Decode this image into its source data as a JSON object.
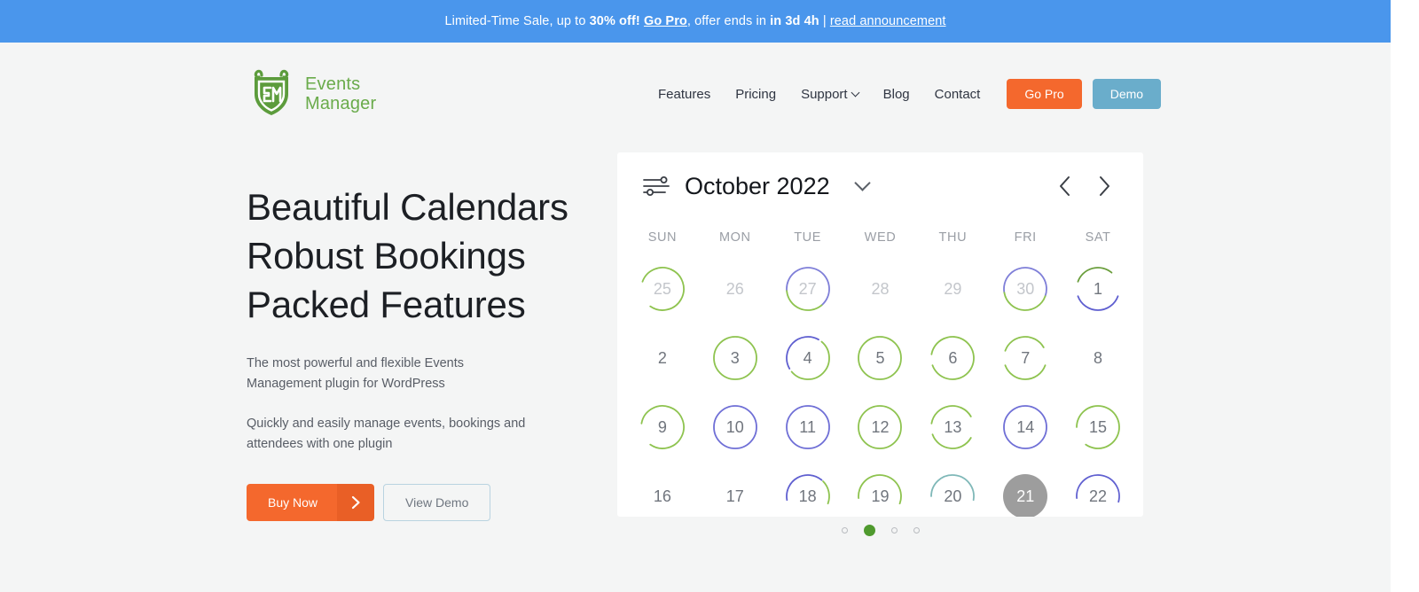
{
  "announcement": {
    "prefix": "Limited-Time Sale, up to ",
    "discount": "30% off!",
    "go_pro_link": "Go Pro",
    "middle": ", offer ends in ",
    "countdown": "in 3d 4h",
    "separator": " | ",
    "read_link": "read announcement",
    "background": "#4a96ec"
  },
  "header": {
    "brand": {
      "line1": "Events",
      "line2": "Manager",
      "logo_icon": "shield-em-logo-icon",
      "color": "#6aab4b"
    },
    "nav": [
      {
        "label": "Features",
        "has_caret": false
      },
      {
        "label": "Pricing",
        "has_caret": false
      },
      {
        "label": "Support",
        "has_caret": true
      },
      {
        "label": "Blog",
        "has_caret": false
      },
      {
        "label": "Contact",
        "has_caret": false
      }
    ],
    "go_pro_button": {
      "label": "Go Pro",
      "color": "#f4682d"
    },
    "demo_button": {
      "label": "Demo",
      "color": "#6aadcb"
    }
  },
  "hero": {
    "heading_lines": [
      "Beautiful Calendars",
      "Robust Bookings",
      "Packed Features"
    ],
    "paragraph_1": "The most powerful and flexible Events Management plugin for WordPress",
    "paragraph_2": "Quickly and easily manage events, bookings and attendees with one plugin",
    "buy_now_button": {
      "label": "Buy Now",
      "arrow_icon": "chevron-right-icon",
      "color": "#f4682d"
    },
    "view_demo_button": {
      "label": "View Demo"
    }
  },
  "calendar": {
    "filter_icon": "sliders-filter-icon",
    "title": "October 2022",
    "dropdown_icon": "chevron-down-icon",
    "prev_icon": "chevron-left-icon",
    "next_icon": "chevron-right-icon",
    "weekdays": [
      "SUN",
      "MON",
      "TUE",
      "WED",
      "THU",
      "FRI",
      "SAT"
    ],
    "colors": {
      "green": "#8ec34f",
      "purple": "#6f6fd6",
      "teal": "#7fb8b8",
      "today_fill": "#9d9d9d"
    },
    "weeks": [
      [
        {
          "day": "25",
          "muted": true,
          "today": false,
          "arcs": [
            {
              "color": "#8ec34f",
              "start": -70,
              "end": 215
            }
          ]
        },
        {
          "day": "26",
          "muted": true,
          "today": false,
          "arcs": []
        },
        {
          "day": "27",
          "muted": true,
          "today": false,
          "arcs": [
            {
              "color": "#7f7fd8",
              "start": -95,
              "end": 140
            },
            {
              "color": "#8ec34f",
              "start": 140,
              "end": 265
            }
          ]
        },
        {
          "day": "28",
          "muted": true,
          "today": false,
          "arcs": []
        },
        {
          "day": "29",
          "muted": true,
          "today": false,
          "arcs": []
        },
        {
          "day": "30",
          "muted": true,
          "today": false,
          "arcs": [
            {
              "color": "#7f7fd8",
              "start": -100,
              "end": 110
            },
            {
              "color": "#8ec34f",
              "start": 110,
              "end": 260
            }
          ]
        },
        {
          "day": "1",
          "muted": false,
          "today": false,
          "arcs": [
            {
              "color": "#6a9e3c",
              "start": -70,
              "end": 40
            },
            {
              "color": "#5f5fd0",
              "start": 110,
              "end": 250
            }
          ]
        }
      ],
      [
        {
          "day": "2",
          "muted": false,
          "today": false,
          "arcs": []
        },
        {
          "day": "3",
          "muted": false,
          "today": false,
          "arcs": [
            {
              "color": "#8ec34f",
              "start": 0,
              "end": 360
            }
          ]
        },
        {
          "day": "4",
          "muted": false,
          "today": false,
          "arcs": [
            {
              "color": "#5f5fd0",
              "start": -120,
              "end": 30
            },
            {
              "color": "#8ec34f",
              "start": 40,
              "end": 230
            }
          ]
        },
        {
          "day": "5",
          "muted": false,
          "today": false,
          "arcs": [
            {
              "color": "#8ec34f",
              "start": 0,
              "end": 360
            }
          ]
        },
        {
          "day": "6",
          "muted": false,
          "today": false,
          "arcs": [
            {
              "color": "#8ec34f",
              "start": -80,
              "end": 250
            }
          ]
        },
        {
          "day": "7",
          "muted": false,
          "today": false,
          "arcs": [
            {
              "color": "#8ec34f",
              "start": -70,
              "end": 60
            },
            {
              "color": "#8ec34f",
              "start": 110,
              "end": 250
            }
          ]
        },
        {
          "day": "8",
          "muted": false,
          "today": false,
          "arcs": []
        }
      ],
      [
        {
          "day": "9",
          "muted": false,
          "today": false,
          "arcs": [
            {
              "color": "#8ec34f",
              "start": -80,
              "end": 215
            }
          ]
        },
        {
          "day": "10",
          "muted": false,
          "today": false,
          "arcs": [
            {
              "color": "#6f6fd6",
              "start": 0,
              "end": 360
            }
          ]
        },
        {
          "day": "11",
          "muted": false,
          "today": false,
          "arcs": [
            {
              "color": "#6f6fd6",
              "start": 0,
              "end": 360
            }
          ]
        },
        {
          "day": "12",
          "muted": false,
          "today": false,
          "arcs": [
            {
              "color": "#8ec34f",
              "start": 0,
              "end": 360
            }
          ]
        },
        {
          "day": "13",
          "muted": false,
          "today": false,
          "arcs": [
            {
              "color": "#8ec34f",
              "start": -80,
              "end": 60
            },
            {
              "color": "#8ec34f",
              "start": 120,
              "end": 250
            }
          ]
        },
        {
          "day": "14",
          "muted": false,
          "today": false,
          "arcs": [
            {
              "color": "#6f6fd6",
              "start": 0,
              "end": 360
            }
          ]
        },
        {
          "day": "15",
          "muted": false,
          "today": false,
          "arcs": [
            {
              "color": "#8ec34f",
              "start": -90,
              "end": 215
            }
          ]
        }
      ],
      [
        {
          "day": "16",
          "muted": false,
          "today": false,
          "arcs": []
        },
        {
          "day": "17",
          "muted": false,
          "today": false,
          "arcs": []
        },
        {
          "day": "18",
          "muted": false,
          "today": false,
          "arcs": [
            {
              "color": "#5f5fd0",
              "start": -100,
              "end": 40
            },
            {
              "color": "#8ec34f",
              "start": 45,
              "end": 110
            }
          ]
        },
        {
          "day": "19",
          "muted": false,
          "today": false,
          "arcs": [
            {
              "color": "#8ec34f",
              "start": -95,
              "end": 110
            }
          ]
        },
        {
          "day": "20",
          "muted": false,
          "today": false,
          "arcs": [
            {
              "color": "#7fb8b8",
              "start": -90,
              "end": 100
            }
          ]
        },
        {
          "day": "21",
          "muted": false,
          "today": true,
          "arcs": []
        },
        {
          "day": "22",
          "muted": false,
          "today": false,
          "arcs": [
            {
              "color": "#5f5fd0",
              "start": -95,
              "end": 105
            }
          ]
        }
      ]
    ]
  },
  "carousel": {
    "dots": [
      {
        "active": false
      },
      {
        "active": true
      },
      {
        "active": false
      },
      {
        "active": false
      }
    ],
    "active_color": "#4f9a2e"
  }
}
